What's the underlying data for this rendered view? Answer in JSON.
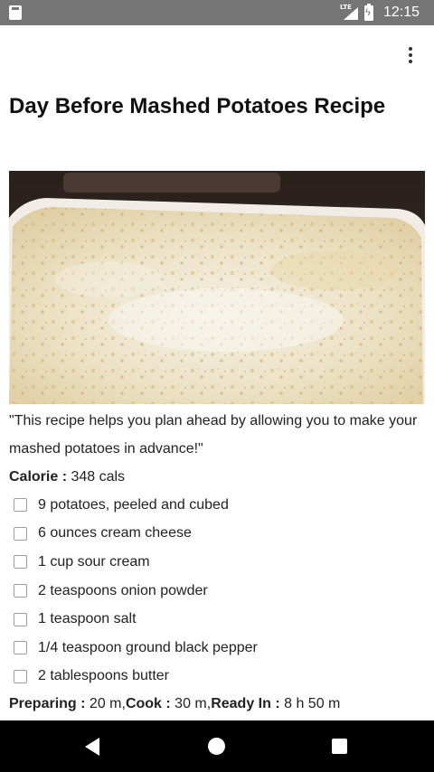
{
  "status_bar": {
    "network": "LTE",
    "time": "12:15",
    "icons": [
      "sd-card-icon",
      "signal-icon",
      "battery-charging-icon"
    ]
  },
  "app_bar": {
    "menu_icon": "overflow-menu-icon"
  },
  "recipe": {
    "title": "Day Before Mashed Potatoes Recipe",
    "image_description_icon": "recipe-photo",
    "quote": "\"This recipe helps you plan ahead by allowing you to make your mashed potatoes in advance!\"",
    "calorie_label": "Calorie :",
    "calorie_value": " 348 cals",
    "ingredients": [
      "9 potatoes, peeled and cubed",
      "6 ounces cream cheese",
      "1 cup sour cream",
      "2 teaspoons onion powder",
      "1 teaspoon salt",
      "1/4 teaspoon ground black pepper",
      "2 tablespoons butter"
    ],
    "times": {
      "preparing_label": "Preparing :",
      "preparing_value": " 20 m,",
      "cook_label": "Cook :",
      "cook_value": " 30 m,",
      "ready_label": "Ready In :",
      "ready_value": " 8 h 50 m"
    }
  },
  "nav_bar": {
    "icons": [
      "back-icon",
      "home-icon",
      "recents-icon"
    ]
  },
  "colors": {
    "status_bar": "#757575",
    "nav_bar": "#000000",
    "text": "#222222",
    "checkbox_border": "#9e9e9e"
  }
}
